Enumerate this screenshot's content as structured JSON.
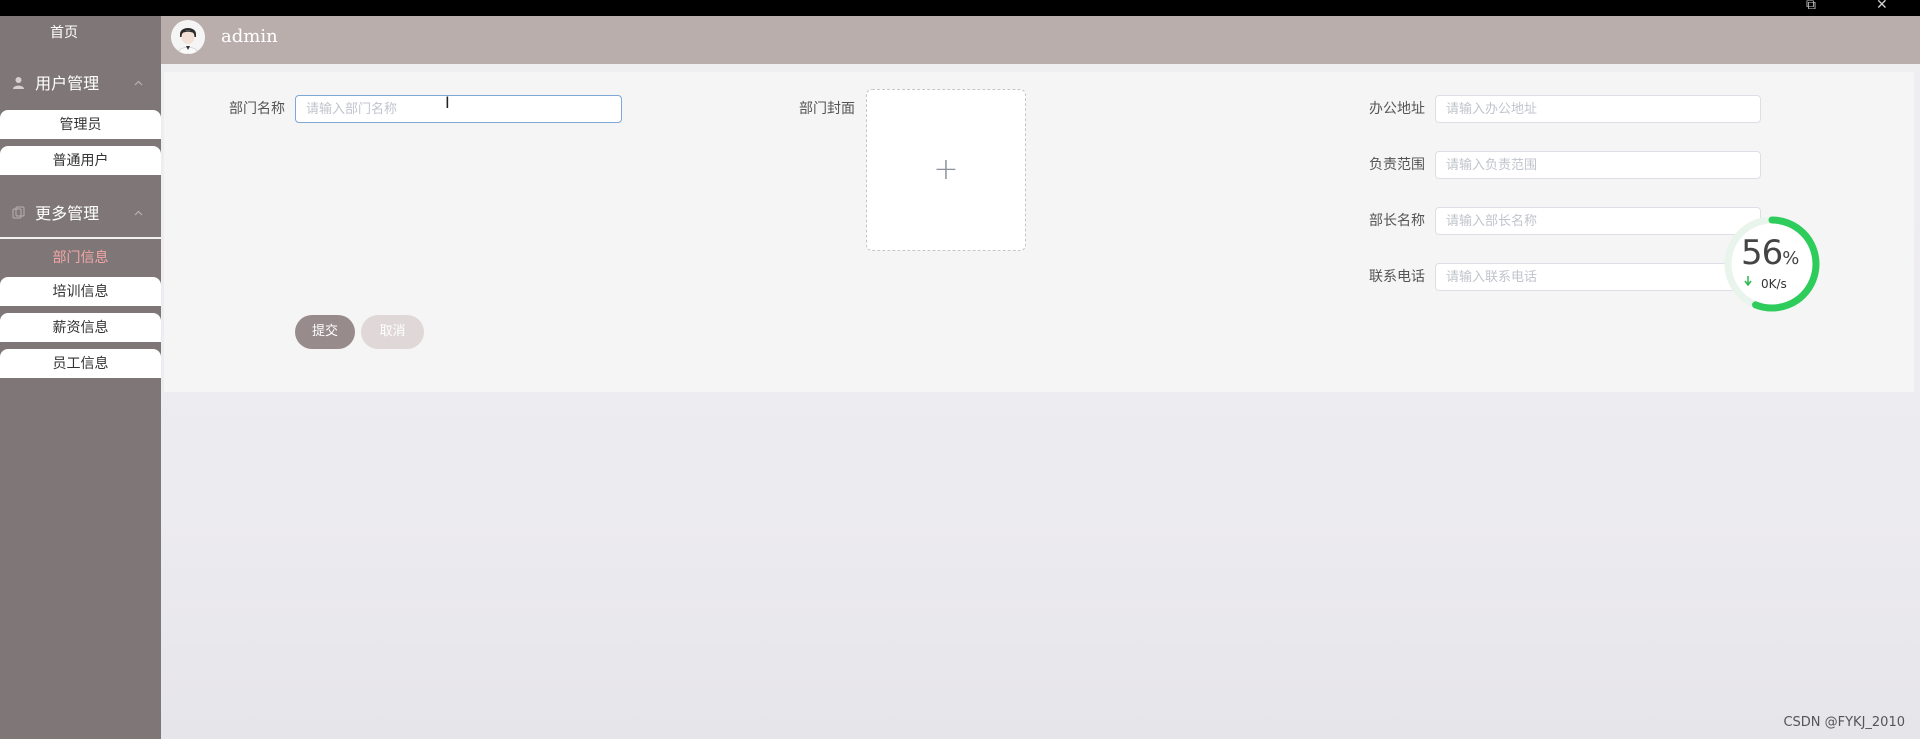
{
  "window": {
    "restore_glyph": "⧉",
    "close_glyph": "✕"
  },
  "sidebar": {
    "home": "首页",
    "groups": [
      {
        "title": "用户管理",
        "icon": "person-icon",
        "items": [
          "管理员",
          "普通用户"
        ]
      },
      {
        "title": "更多管理",
        "icon": "copy-icon",
        "items": [
          "部门信息",
          "培训信息",
          "薪资信息",
          "员工信息"
        ]
      }
    ],
    "active_item": "部门信息",
    "active_color": "#f2a6a6",
    "background_color": "#7f7777"
  },
  "header": {
    "username": "admin",
    "background_color": "#b9aeac"
  },
  "form": {
    "dept_name": {
      "label": "部门名称",
      "placeholder": "请输入部门名称"
    },
    "dept_cover": {
      "label": "部门封面",
      "upload_glyph": "+"
    },
    "office_address": {
      "label": "办公地址",
      "placeholder": "请输入办公地址"
    },
    "responsibility": {
      "label": "负责范围",
      "placeholder": "请输入负责范围"
    },
    "minister_name": {
      "label": "部长名称",
      "placeholder": "请输入部长名称"
    },
    "phone": {
      "label": "联系电话",
      "placeholder": "请输入联系电话"
    },
    "submit_label": "提交",
    "cancel_label": "取消"
  },
  "speed_widget": {
    "percent": "56",
    "percent_sign": "%",
    "rate": "0K/s",
    "progress": 0.56,
    "ring_color": "#2ecc5a"
  },
  "footer": {
    "credit": "CSDN @FYKJ_2010"
  }
}
